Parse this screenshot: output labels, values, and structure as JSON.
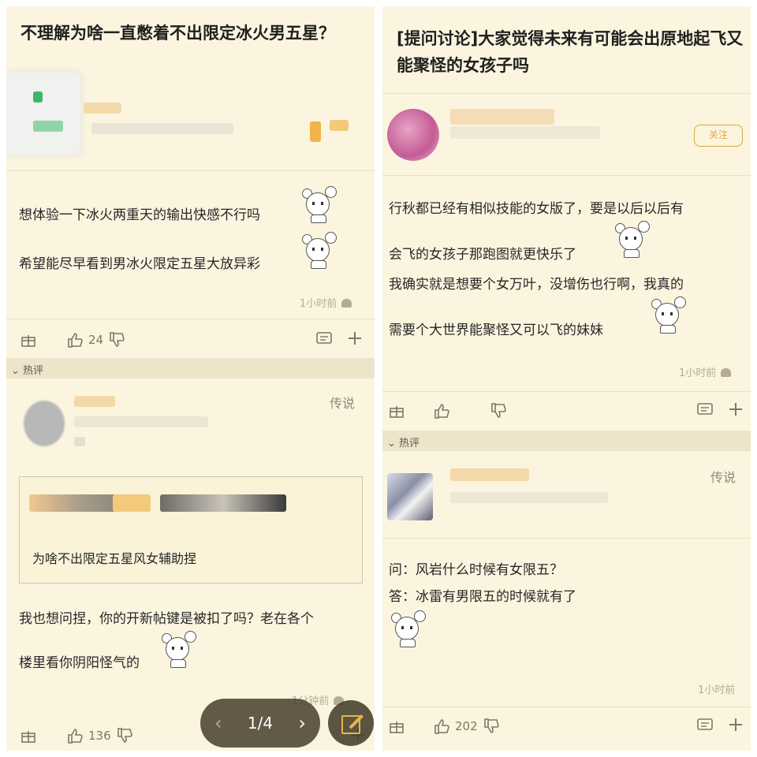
{
  "left": {
    "title": "不理解为啥一直憋着不出限定冰火男五星？",
    "post_lines": [
      "想体验一下冰火两重天的输出快感不行吗",
      "希望能尽早看到男冰火限定五星大放异彩"
    ],
    "post_time": "1小时前",
    "post_like_count": "24",
    "hot_label": "热评",
    "comment_badge": "传说",
    "quote_text": "为啥不出限定五星风女辅助捏",
    "reply_lines": [
      "我也想问捏，你的开新帖键是被扣了吗？老在各个",
      "楼里看你阴阳怪气的"
    ],
    "reply_time": "1分钟前",
    "reply_like_count": "136",
    "pager_text": "1/4"
  },
  "right": {
    "title": "[提问讨论]大家觉得未来有可能会出原地起飞又能聚怪的女孩子吗",
    "follow_label": "关注",
    "post_lines": [
      "行秋都已经有相似技能的女版了，要是以后以后有",
      "会飞的女孩子那跑图就更快乐了",
      "我确实就是想要个女万叶，没增伤也行啊，我真的",
      "需要个大世界能聚怪又可以飞的妹妹"
    ],
    "post_time": "1小时前",
    "hot_label": "热评",
    "comment_badge": "传说",
    "answer_lines": [
      "问：风岩什么时候有女限五？",
      "答：冰雷有男限五的时候就有了"
    ],
    "answer_time": "1小时前",
    "answer_like_count": "202"
  },
  "colors": {
    "background": "#fbf5df",
    "accent": "#d9a73b",
    "hot_bar": "#ece5ca"
  },
  "icons": [
    "gift-icon",
    "thumb-up-icon",
    "thumb-down-icon",
    "comment-icon",
    "plus-icon",
    "android-icon",
    "edit-icon",
    "chevron-left-icon",
    "chevron-right-icon"
  ]
}
